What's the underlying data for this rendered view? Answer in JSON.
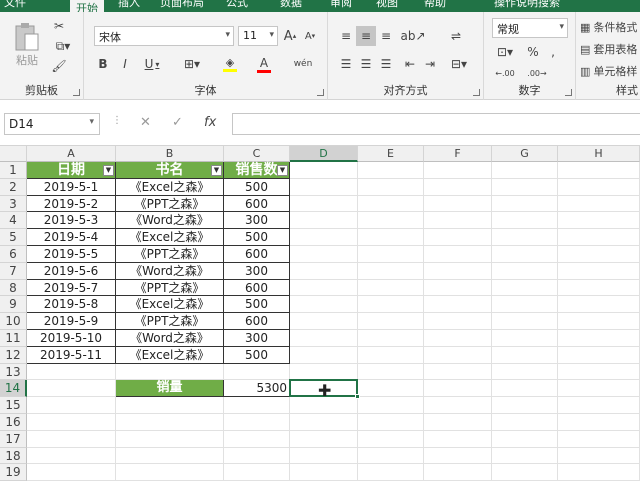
{
  "tabs": [
    "文件",
    "开始",
    "插入",
    "页面布局",
    "公式",
    "数据",
    "审阅",
    "视图",
    "帮助",
    "操作说明搜索"
  ],
  "active_tab": "开始",
  "ribbon": {
    "clipboard": {
      "paste": "粘贴",
      "label": "剪贴板"
    },
    "font": {
      "name": "宋体",
      "size": "11",
      "label": "字体",
      "bold": "B",
      "italic": "I",
      "underline": "U",
      "grow": "A",
      "shrink": "A",
      "wen": "wén"
    },
    "align": {
      "label": "对齐方式"
    },
    "number": {
      "format": "常规",
      "label": "数字",
      "percent": "%",
      "comma": ","
    },
    "styles": {
      "cond": "条件格式",
      "table": "套用表格",
      "cell": "单元格样",
      "label": "样式"
    }
  },
  "namebox": "D14",
  "fx": "fx",
  "columns": [
    "A",
    "B",
    "C",
    "D",
    "E",
    "F",
    "G",
    "H"
  ],
  "rows": [
    "1",
    "2",
    "3",
    "4",
    "5",
    "6",
    "7",
    "8",
    "9",
    "10",
    "11",
    "12",
    "13",
    "14",
    "15",
    "16",
    "17",
    "18",
    "19"
  ],
  "selected_col": "D",
  "selected_row": "14",
  "header_row": {
    "a": "日期",
    "b": "书名",
    "c": "销售数"
  },
  "data": [
    {
      "date": "2019-5-1",
      "book": "《Excel之森》",
      "qty": "500"
    },
    {
      "date": "2019-5-2",
      "book": "《PPT之森》",
      "qty": "600"
    },
    {
      "date": "2019-5-3",
      "book": "《Word之森》",
      "qty": "300"
    },
    {
      "date": "2019-5-4",
      "book": "《Excel之森》",
      "qty": "500"
    },
    {
      "date": "2019-5-5",
      "book": "《PPT之森》",
      "qty": "600"
    },
    {
      "date": "2019-5-6",
      "book": "《Word之森》",
      "qty": "300"
    },
    {
      "date": "2019-5-7",
      "book": "《PPT之森》",
      "qty": "600"
    },
    {
      "date": "2019-5-8",
      "book": "《Excel之森》",
      "qty": "500"
    },
    {
      "date": "2019-5-9",
      "book": "《PPT之森》",
      "qty": "600"
    },
    {
      "date": "2019-5-10",
      "book": "《Word之森》",
      "qty": "300"
    },
    {
      "date": "2019-5-11",
      "book": "《Excel之森》",
      "qty": "500"
    }
  ],
  "summary": {
    "label": "销量",
    "value": "5300"
  },
  "colors": {
    "excel_green": "#217346",
    "header_green": "#70ad47"
  }
}
